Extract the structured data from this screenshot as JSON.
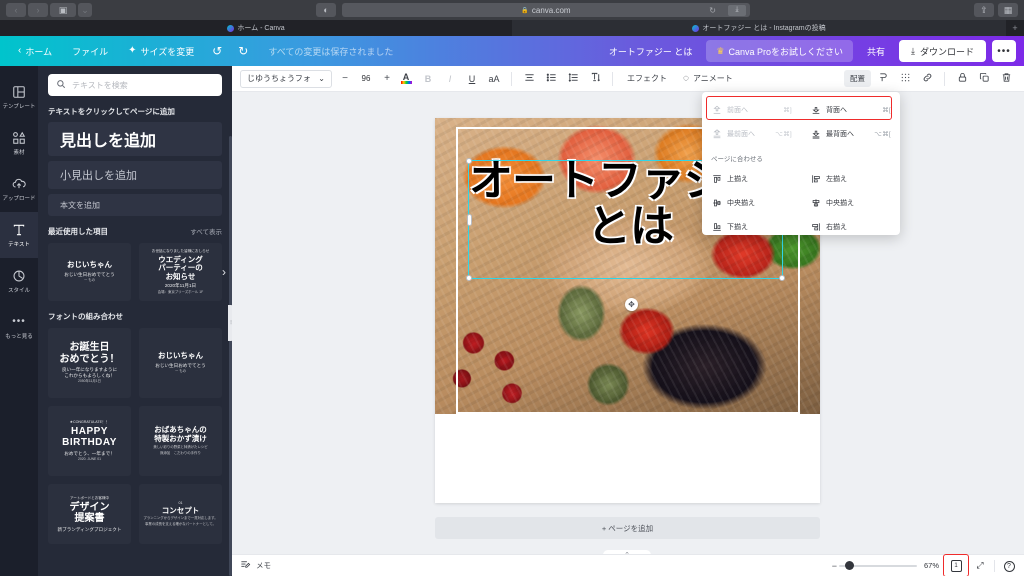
{
  "browser": {
    "back_icon": "‹",
    "forward_icon": "›",
    "sidebar_icon": "▣",
    "sidebar_caret": "⌄",
    "theme_icon": "◐",
    "url": "canva.com",
    "lock_icon": "🔒",
    "reload_icon": "↻",
    "download_icon": "⤓",
    "share_icon": "⇪",
    "tabs_icon": "▦",
    "tab_inactive_title": "ホーム - Canva",
    "tab_active_title": "オートファジー とは - Instagramの投稿",
    "new_tab_icon": "+"
  },
  "topbar": {
    "home_label": "ホーム",
    "home_icon": "‹",
    "file_label": "ファイル",
    "resize_label": "サイズを変更",
    "resize_icon": "✦",
    "undo_icon": "↺",
    "redo_icon": "↻",
    "saved_status": "すべての変更は保存されました",
    "doc_title": "オートファジー とは",
    "pro_label": "Canva Proをお試しください",
    "pro_icon": "♛",
    "share_label": "共有",
    "download_label": "ダウンロード",
    "download_icon": "⤓",
    "more_label": "•••"
  },
  "rail": {
    "items": [
      {
        "label": "テンプレート",
        "icon": "templates-icon",
        "active": false
      },
      {
        "label": "素材",
        "icon": "elements-icon",
        "active": false
      },
      {
        "label": "アップロード",
        "icon": "upload-icon",
        "active": false
      },
      {
        "label": "テキスト",
        "icon": "text-icon",
        "active": true
      },
      {
        "label": "スタイル",
        "icon": "styles-icon",
        "active": false
      },
      {
        "label": "もっと見る",
        "icon": "more-icon",
        "active": false
      }
    ]
  },
  "panel": {
    "search_placeholder": "テキストを検索",
    "search_value": "",
    "click_to_add_label": "テキストをクリックしてページに追加",
    "heading_label": "見出しを追加",
    "subheading_label": "小見出しを追加",
    "body_label": "本文を追加",
    "recent_title": "最近使用した項目",
    "see_all_label": "すべて表示",
    "recent_cards": [
      {
        "tiny": "",
        "mid": "おじいちゃん",
        "sub": "おじい生日おめでてとう",
        "xs": "ー もの"
      },
      {
        "tiny": "お世話になりました皆様におしらせ",
        "mid": "ウエディング\nパーティーの\nお知らせ",
        "sub": "2020年11月1日",
        "xs": "会場：東京ブリーズホール 1F"
      }
    ],
    "card_arrow_icon": "›",
    "font_combo_title": "フォントの組み合わせ",
    "font_combo_cards": [
      {
        "tiny": "",
        "mid": "お誕生日\nおめでとう！",
        "sub": "良い一年になりますように\nこれからもよろしくね！",
        "xs": "2050年11月1日"
      },
      {
        "tiny": "",
        "mid": "おじいちゃん",
        "sub": "おじい生日おめでてとう",
        "xs": "ー もの"
      },
      {
        "tiny": "★CONGRATULATE！！",
        "mid": "HAPPY\nBIRTHDAY",
        "sub": "おめでとう、一年まで！",
        "xs": "2020. JUNE 01"
      },
      {
        "tiny": "",
        "mid": "おばあちゃんの\n特製おかず漬け",
        "sub": "美しい彩りの野菜と柿漬けたレシピ",
        "xs": "無添加　こだわりの手作り"
      }
    ],
    "extra_cards": [
      {
        "tiny": "アートボードとお客様中",
        "mid": "デザイン\n提案書",
        "sub": "新ブランディングプロジェクト",
        "xs": ""
      },
      {
        "tiny": "01",
        "mid": "コンセプト",
        "sub": "プランニングからデザインまで一貫対応します。",
        "xs": "事業の成長を支える確かなパートナーとして。"
      }
    ],
    "handle_icon": "⦙"
  },
  "toolbar": {
    "font_name": "じゆうちょうフォン...",
    "font_caret": "⌄",
    "size_minus": "−",
    "size_value": "96",
    "size_plus": "+",
    "text_color_icon": "A",
    "bold_label": "B",
    "italic_label": "I",
    "underline_label": "U",
    "case_label": "aA",
    "align_icon": "align-icon",
    "list_icon": "list-icon",
    "spacing_icon": "spacing-icon",
    "vertical_text_icon": "vertical-text-icon",
    "effects_label": "エフェクト",
    "animate_label": "アニメート",
    "animate_icon": "◌",
    "arrange_label": "配置",
    "position_icon": "position-icon",
    "transparency_icon": "transparency-icon",
    "link_icon": "link-icon",
    "lock_icon": "lock-icon",
    "duplicate_icon": "duplicate-icon",
    "delete_icon": "trash-icon"
  },
  "popover": {
    "forward_label": "前面へ",
    "forward_key": "⌘]",
    "backward_label": "背面へ",
    "backward_key": "⌘[",
    "to_front_label": "最前面へ",
    "to_front_key": "⌥⌘]",
    "to_back_label": "最背面へ",
    "to_back_key": "⌥⌘[",
    "fit_page_label": "ページに合わせる",
    "align_top_label": "上揃え",
    "align_middle_label": "中央揃え",
    "align_bottom_label": "下揃え",
    "align_left_label": "左揃え",
    "align_center_label": "中央揃え",
    "align_right_label": "右揃え",
    "highlight_color": "#ef2b2b"
  },
  "canvas": {
    "headline_line1": "オートファジー",
    "headline_line2": "とは",
    "rotate_icon": "✥",
    "add_page_label": "+ ページを追加",
    "collapse_icon": "⌃"
  },
  "bottombar": {
    "notes_label": "メモ",
    "zoom_minus": "−",
    "zoom_percent": "67%",
    "page_number": "1",
    "fullscreen_icon": "⤢",
    "help_icon": "?"
  }
}
